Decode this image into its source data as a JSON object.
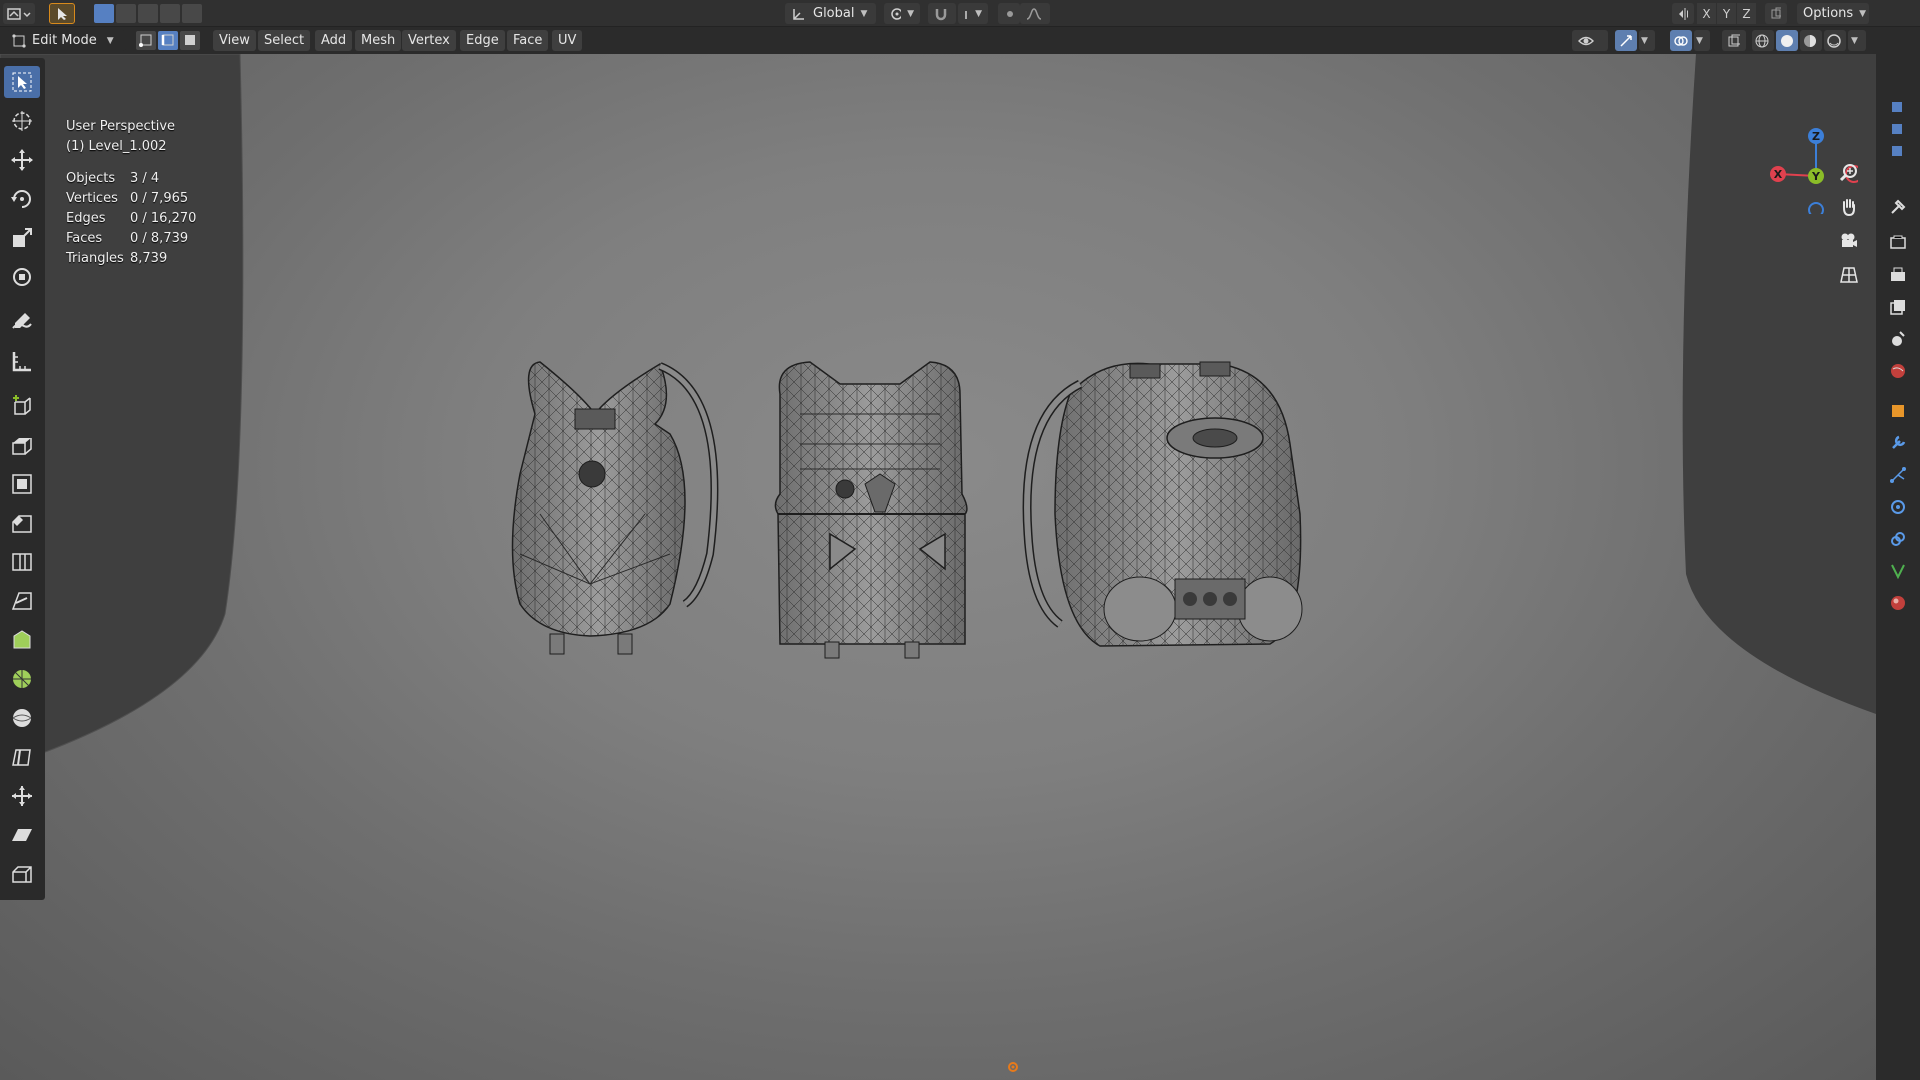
{
  "header": {
    "transform_orientation": "Global",
    "axes": [
      "X",
      "Y",
      "Z"
    ],
    "options_label": "Options"
  },
  "toolbar": {
    "mode": "Edit Mode",
    "menus": [
      "View",
      "Select",
      "Add",
      "Mesh",
      "Vertex",
      "Edge",
      "Face",
      "UV"
    ]
  },
  "viewport": {
    "perspective": "User Perspective",
    "object_name": "(1) Level_1.002",
    "stats": [
      {
        "label": "Objects",
        "value": "3 / 4"
      },
      {
        "label": "Vertices",
        "value": "0 / 7,965"
      },
      {
        "label": "Edges",
        "value": "0 / 16,270"
      },
      {
        "label": "Faces",
        "value": "0 / 8,739"
      },
      {
        "label": "Triangles",
        "value": "8,739"
      }
    ]
  },
  "gizmo": {
    "x_label": "X",
    "y_label": "Y",
    "z_label": "Z"
  },
  "colors": {
    "x_axis": "#e0414e",
    "y_axis": "#8bbd28",
    "z_axis": "#3c7fd8",
    "active_tool": "#4a6fa8",
    "header_bg": "#303030"
  },
  "tools": [
    "select-box-icon",
    "cursor-icon",
    "move-icon",
    "rotate-icon",
    "scale-icon",
    "transform-icon",
    "annotate-icon",
    "measure-icon",
    "add-cube-icon",
    "extrude-icon",
    "inset-icon",
    "bevel-icon",
    "loop-cut-icon",
    "knife-icon",
    "poly-build-icon",
    "spin-icon",
    "smooth-icon",
    "edge-slide-icon",
    "shrink-fatten-icon",
    "shear-icon",
    "rip-icon"
  ],
  "properties_tabs": [
    "tool-icon",
    "render-icon",
    "output-icon",
    "view-layer-icon",
    "scene-icon",
    "world-icon",
    "object-icon",
    "modifier-icon",
    "particles-icon",
    "physics-icon",
    "constraints-icon",
    "data-icon",
    "material-icon"
  ]
}
